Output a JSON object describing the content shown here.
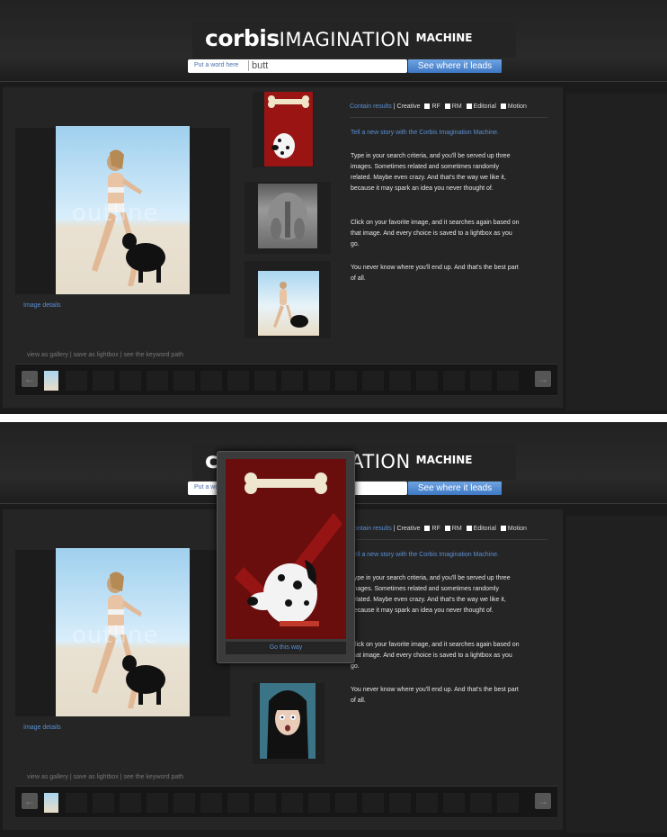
{
  "header": {
    "logo_corbis": "corbis",
    "logo_imagination": "IMAGINATION",
    "logo_machine": "MACHINE",
    "search_placeholder": "Put a word here",
    "search_value": "butt",
    "go_button": "See where it leads"
  },
  "main": {
    "watermark": "outline",
    "image_details": "Image details"
  },
  "filters": {
    "contain_results": "Contain results",
    "sep": "|",
    "creative": "Creative",
    "rf": "RF",
    "rm": "RM",
    "editorial": "Editorial",
    "motion": "Motion"
  },
  "info": {
    "tagline": "Tell a new story with the Corbis Imagination Machine.",
    "p1": "Type in your search criteria, and you'll be served up three images. Sometimes related and sometimes randomly related. Maybe even crazy. And that's the way we like it, because it may spark an idea you never thought of.",
    "p2": "Click on your favorite image, and it searches again based on that image. And every choice is saved to a lightbox as you go.",
    "p3": "You never know where you'll end up. And that's the best part of all."
  },
  "footer": {
    "links": "view as gallery | save as lightbox | see the keyword path",
    "prev": "←",
    "next": "→"
  },
  "popup": {
    "go_label": "Go this way"
  },
  "colors": {
    "link_blue": "#5b8fd4",
    "button_blue": "#4d8ad3",
    "background": "#1b1b1b",
    "popup_red": "#6a0d0d"
  }
}
